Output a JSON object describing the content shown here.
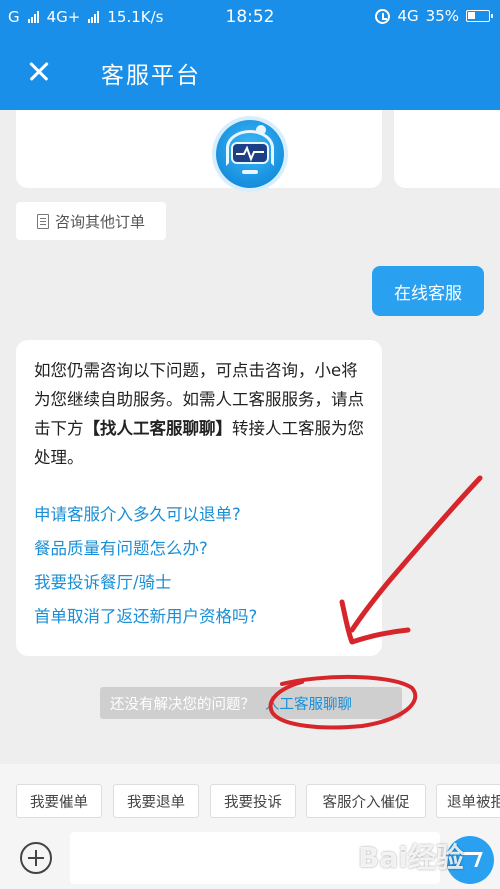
{
  "status_bar": {
    "carrier_1": "G",
    "carrier_2": "4G+",
    "net_speed": "15.1K/s",
    "time": "18:52",
    "carrier_3": "4G",
    "battery": "35%"
  },
  "header": {
    "title": "客服平台"
  },
  "chat": {
    "order_chip_label": "咨询其他订单",
    "user_message": "在线客服",
    "bot_intro_part1": "如您仍需咨询以下问题，可点击咨询，小e将为您继续自助服务。如需人工客服服务，请点击下方",
    "bot_intro_bold": "【找人工客服聊聊】",
    "bot_intro_part2": "转接人工客服为您处理。",
    "questions": [
      "申请客服介入多久可以退单?",
      "餐品质量有问题怎么办?",
      "我要投诉餐厅/骑士",
      "首单取消了返还新用户资格吗?"
    ],
    "hint_text": "还没有解决您的问题？",
    "hint_link": "人工客服聊聊"
  },
  "quick_replies": [
    "我要催单",
    "我要退单",
    "我要投诉",
    "客服介入催促",
    "退单被拒"
  ],
  "input": {
    "placeholder": ""
  },
  "watermark": "Bai经验",
  "colors": {
    "brand_blue": "#1a8fea",
    "link_blue": "#1a8fd6",
    "annotation_red": "#d6262b"
  }
}
